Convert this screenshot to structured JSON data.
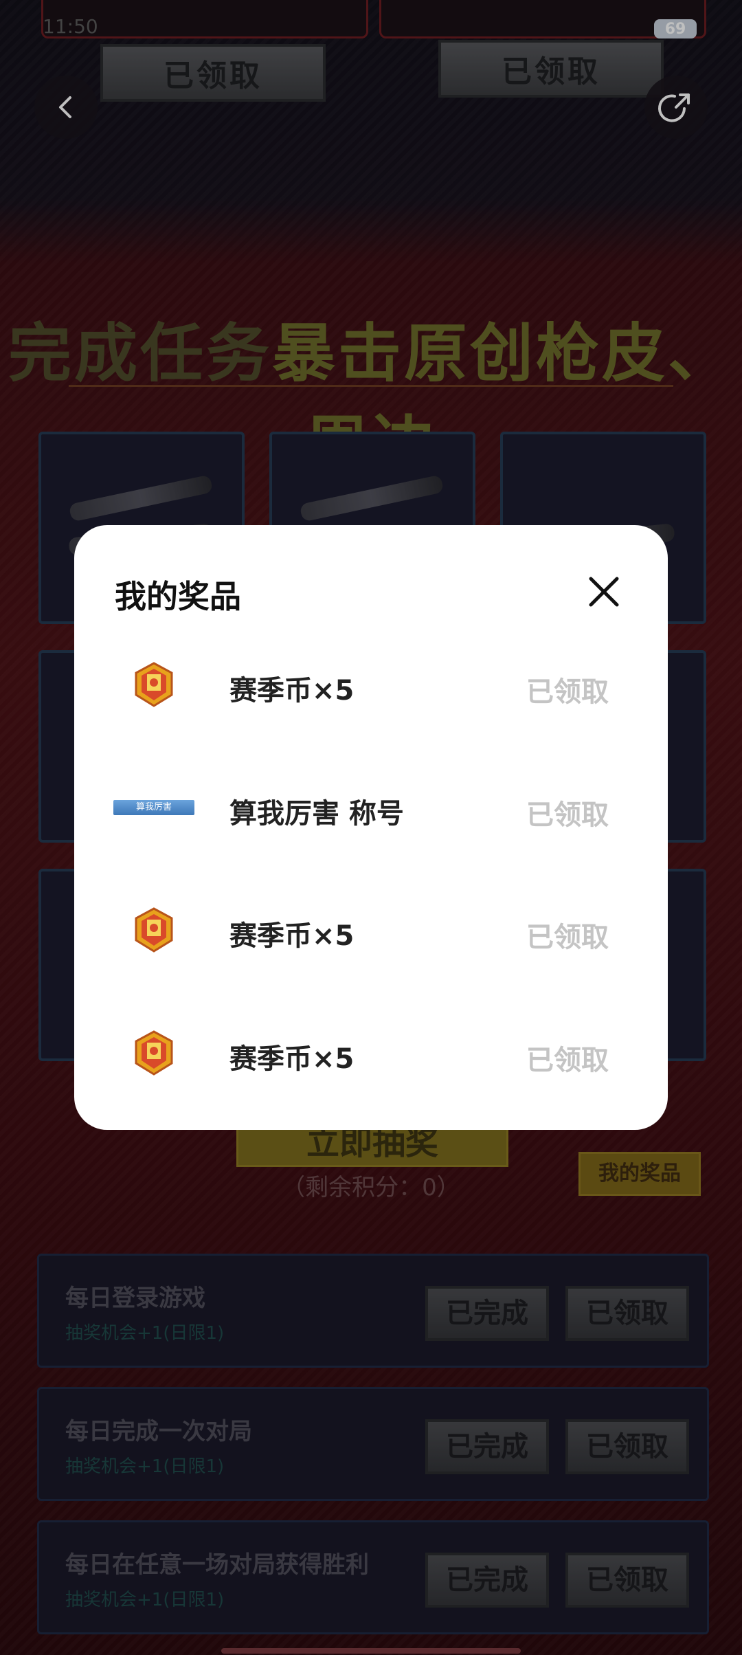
{
  "status_bar": {
    "time": "11:50",
    "battery": "69"
  },
  "header": {
    "claim_left": "已领取",
    "claim_right": "已领取"
  },
  "banner": {
    "title_part1": "完成任务",
    "title_part2": "暴击原创枪皮、周边"
  },
  "lottery": {
    "button_label": "立即抽奖",
    "points_text": "（剩余积分：0）",
    "my_prizes_label": "我的奖品"
  },
  "tasks": [
    {
      "title": "每日登录游戏",
      "sub": "抽奖机会+1(日限1)",
      "done": "已完成",
      "claim": "已领取"
    },
    {
      "title": "每日完成一次对局",
      "sub": "抽奖机会+1(日限1)",
      "done": "已完成",
      "claim": "已领取"
    },
    {
      "title": "每日在任意一场对局获得胜利",
      "sub": "抽奖机会+1(日限1)",
      "done": "已完成",
      "claim": "已领取"
    }
  ],
  "modal": {
    "title": "我的奖品",
    "items": [
      {
        "icon": "season-coin-icon",
        "name": "赛季币×5",
        "status": "已领取"
      },
      {
        "icon": "title-badge-icon",
        "badge_text": "算我厉害",
        "name": "算我厉害 称号",
        "status": "已领取"
      },
      {
        "icon": "season-coin-icon",
        "name": "赛季币×5",
        "status": "已领取"
      },
      {
        "icon": "season-coin-icon",
        "name": "赛季币×5",
        "status": "已领取"
      }
    ]
  },
  "colors": {
    "modal_bg": "#ffffff",
    "status_claimed": "#c4c4c4",
    "page_red": "#4a1216"
  }
}
